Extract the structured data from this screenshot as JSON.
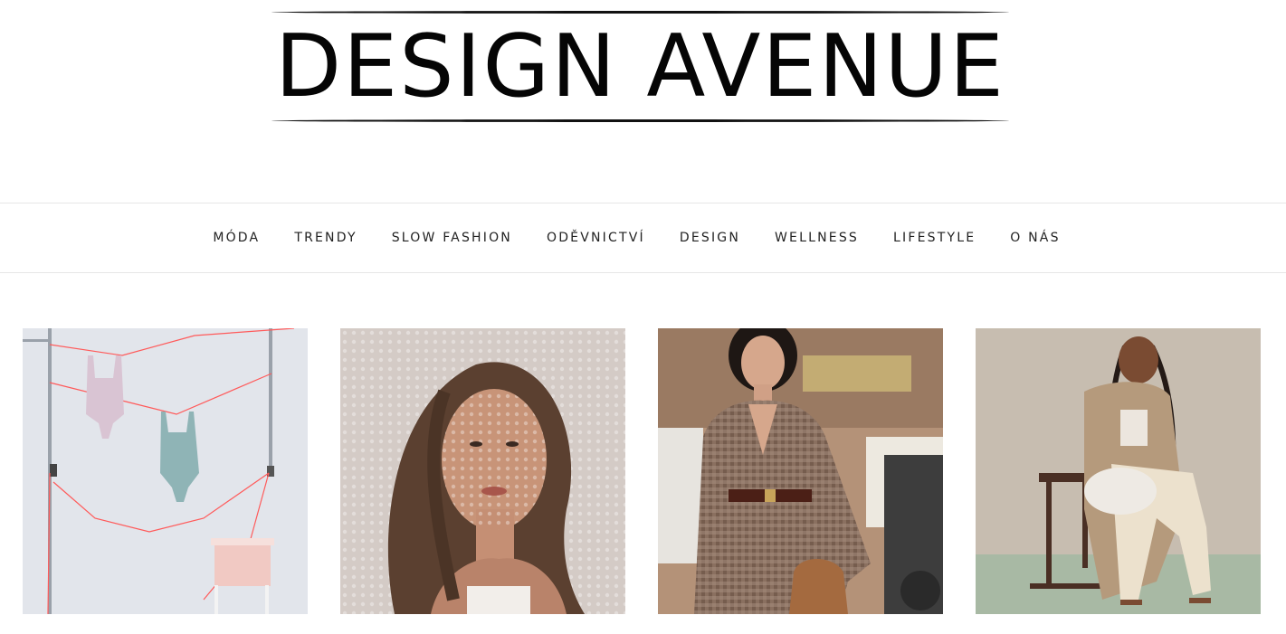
{
  "site": {
    "logo_text": "DESIGN AVENUE"
  },
  "nav": {
    "items": [
      {
        "label": "MÓDA"
      },
      {
        "label": "TRENDY"
      },
      {
        "label": "SLOW FASHION"
      },
      {
        "label": "ODĚVNICTVÍ"
      },
      {
        "label": "DESIGN"
      },
      {
        "label": "WELLNESS"
      },
      {
        "label": "LIFESTYLE"
      },
      {
        "label": "O NÁS"
      }
    ]
  },
  "posts": [
    {
      "image": "bodysuits-on-clothesline-photo"
    },
    {
      "image": "woman-lace-shadow-portrait-photo"
    },
    {
      "image": "woman-checked-blazer-street-photo"
    },
    {
      "image": "woman-braids-chair-photo"
    }
  ]
}
